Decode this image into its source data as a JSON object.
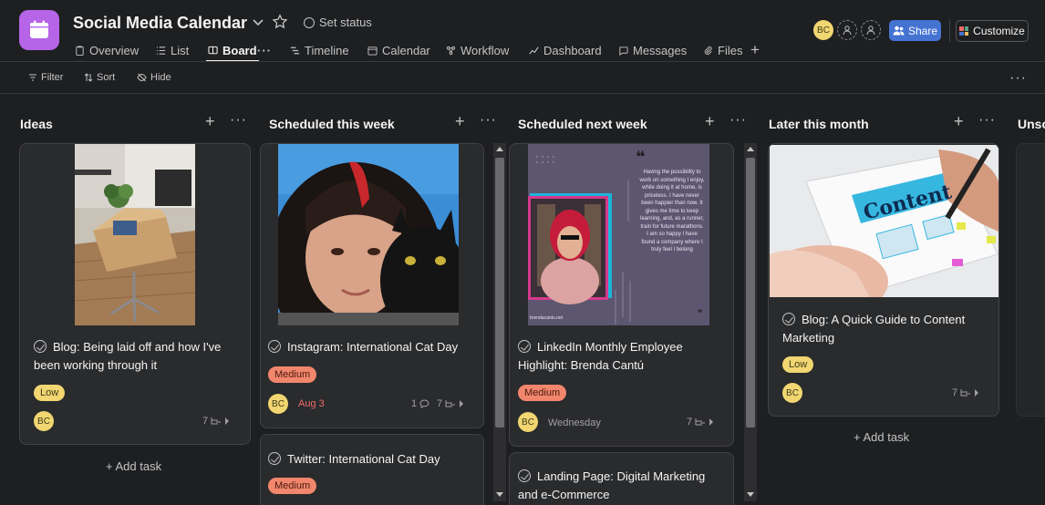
{
  "project": {
    "title": "Social Media Calendar",
    "set_status": "Set status",
    "tabs": [
      "Overview",
      "List",
      "Board",
      "Timeline",
      "Calendar",
      "Workflow",
      "Dashboard",
      "Messages",
      "Files"
    ],
    "active_tab": "Board",
    "tab_more": "···",
    "add_tab": "+"
  },
  "header_right": {
    "avatar_initials": "BC",
    "share_label": "Share",
    "customize_label": "Customize"
  },
  "toolbar": {
    "filter": "Filter",
    "sort": "Sort",
    "hide": "Hide",
    "more": "···"
  },
  "columns": [
    {
      "title": "Ideas",
      "add_task": "+ Add task",
      "cards": [
        {
          "title": "Blog: Being laid off and how I've been working through it",
          "tag": "Low",
          "avatar": "BC",
          "due": "",
          "comments": "",
          "subtasks": "7"
        }
      ]
    },
    {
      "title": "Scheduled this week",
      "cards": [
        {
          "title": "Instagram: International Cat Day",
          "tag": "Medium",
          "avatar": "BC",
          "due": "Aug 3",
          "comments": "1",
          "subtasks": "7"
        },
        {
          "title": "Twitter: International Cat Day",
          "tag": "Medium"
        }
      ]
    },
    {
      "title": "Scheduled next week",
      "cards": [
        {
          "title": "LinkedIn Monthly Employee Highlight: Brenda Cantú",
          "tag": "Medium",
          "avatar": "BC",
          "due": "Wednesday",
          "comments": "",
          "subtasks": "7",
          "quote": "Having the possibility to work on something I enjoy, while doing it at home, is priceless. I have never been happier than now. It gives me time to keep learning, and, as a runner, train for future marathons. I am so happy I have found a company where I truly feel I belong",
          "site": "brendacantu.net"
        },
        {
          "title": "Landing Page: Digital Marketing and e-Commerce"
        }
      ]
    },
    {
      "title": "Later this month",
      "add_task": "+ Add task",
      "cards": [
        {
          "title": "Blog: A Quick Guide to Content Marketing",
          "tag": "Low",
          "avatar": "BC",
          "due": "",
          "comments": "",
          "subtasks": "7",
          "image_text": "Content"
        }
      ]
    },
    {
      "title": "Unsc"
    }
  ],
  "colors": {
    "background": "#1e1f21",
    "card": "#2a2b2d",
    "low_tag": "#f1d671",
    "medium_tag": "#f2866c",
    "share": "#4573d2",
    "project_icon": "#b664e8",
    "due_red": "#f06a6a"
  }
}
